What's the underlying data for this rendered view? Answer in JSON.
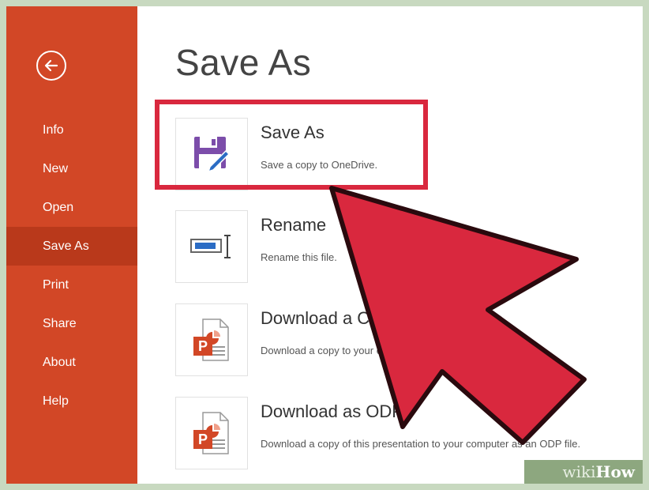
{
  "sidebar": {
    "back_label": "Back",
    "items": [
      {
        "label": "Info"
      },
      {
        "label": "New"
      },
      {
        "label": "Open"
      },
      {
        "label": "Save As",
        "active": true
      },
      {
        "label": "Print"
      },
      {
        "label": "Share"
      },
      {
        "label": "About"
      },
      {
        "label": "Help"
      }
    ]
  },
  "main": {
    "title": "Save As",
    "options": [
      {
        "title": "Save As",
        "description": "Save a copy to OneDrive.",
        "icon": "save-as-icon"
      },
      {
        "title": "Rename",
        "description": "Rename this file.",
        "icon": "rename-icon"
      },
      {
        "title": "Download a Copy",
        "description": "Download a copy to your computer.",
        "icon": "powerpoint-file-icon"
      },
      {
        "title": "Download as ODP",
        "description": "Download a copy of this presentation to your computer as an ODP file.",
        "icon": "powerpoint-file-icon"
      }
    ]
  },
  "watermark": {
    "wiki": "wiki",
    "how": "How"
  },
  "colors": {
    "sidebar": "#d24726",
    "sidebar_active": "#b9391b",
    "highlight": "#d9283e",
    "arrow": "#d9283e",
    "save_icon": "#7c4daa"
  }
}
